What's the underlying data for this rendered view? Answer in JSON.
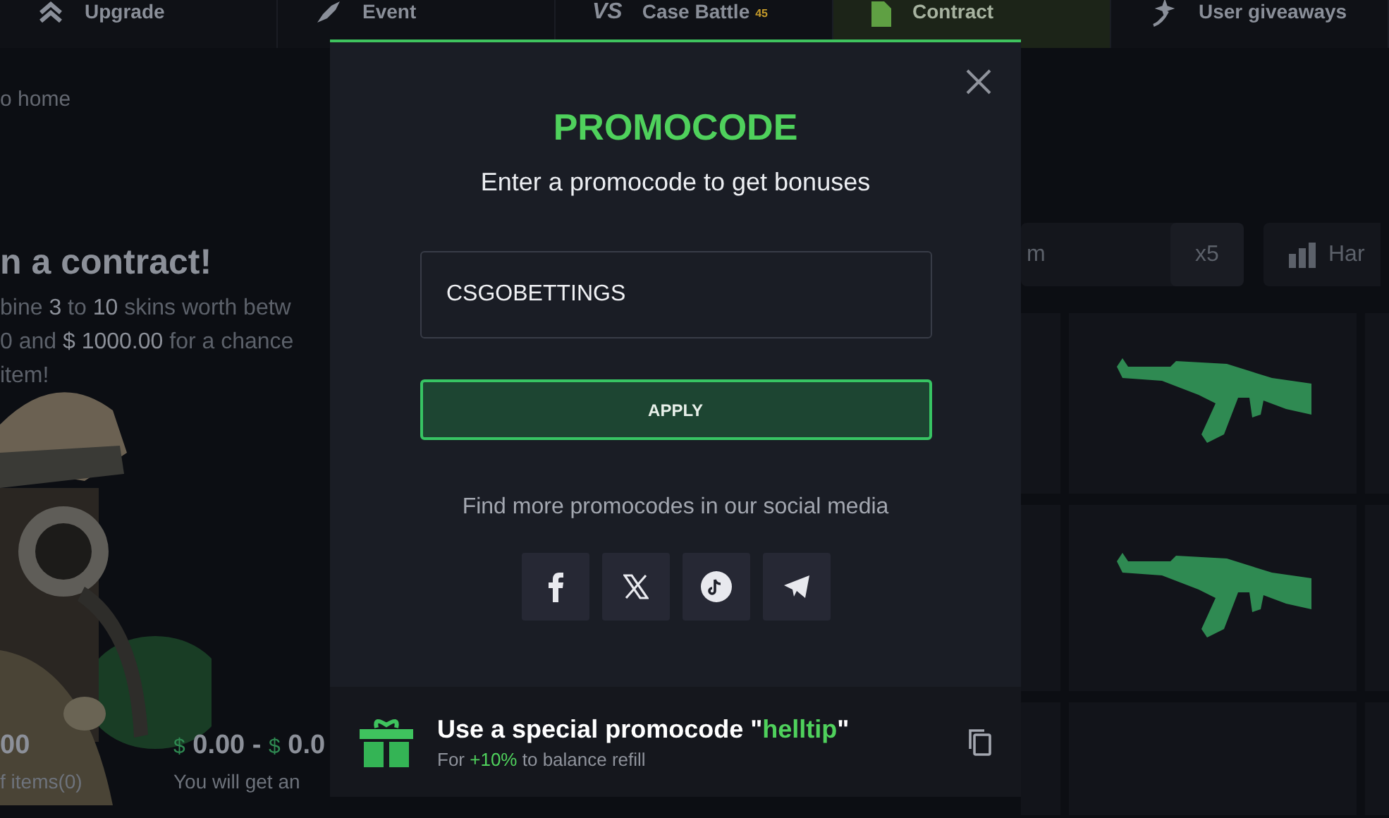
{
  "nav": [
    {
      "kind": "upgrade",
      "label": "Upgrade",
      "selected": false
    },
    {
      "kind": "event",
      "label": "Event",
      "selected": false
    },
    {
      "kind": "battle",
      "glyph": "VS",
      "label": "Case Battle",
      "badge": "45",
      "selected": false
    },
    {
      "kind": "contract",
      "label": "Contract",
      "selected": true
    },
    {
      "kind": "giveaway",
      "label": "User giveaways",
      "selected": false
    }
  ],
  "page": {
    "breadcrumb": "o home",
    "heading": "n a contract!",
    "description": [
      "bine **3** to **10** skins worth betw",
      "0 and **$ 1000.00** for a chance",
      "item!"
    ],
    "stats": [
      {
        "parts": [
          {
            "kind": "amount",
            "text": "00"
          }
        ],
        "label": "f items(0)"
      },
      {
        "parts": [
          {
            "kind": "currency",
            "text": "$"
          },
          {
            "kind": "amount",
            "text": " 0.00 - "
          },
          {
            "kind": "currency",
            "text": "$"
          },
          {
            "kind": "amount",
            "text": " 0.0"
          }
        ],
        "label": "You will get an"
      }
    ]
  },
  "toolbar": {
    "search": {
      "placeholder": "m"
    },
    "multiplier": "x5",
    "difficulty": "Har"
  },
  "cards": [
    {
      "kind": "empty"
    },
    {
      "kind": "rifle"
    },
    {
      "kind": "empty"
    },
    {
      "kind": "empty"
    },
    {
      "kind": "rifle"
    },
    {
      "kind": "empty"
    },
    {
      "kind": "empty"
    },
    {
      "kind": "empty"
    },
    {
      "kind": "empty"
    }
  ],
  "modal": {
    "title": "PROMOCODE",
    "subtitle": "Enter a promocode to get bonuses",
    "code": {
      "value": "CSGOBETTINGS"
    },
    "apply": "APPLY",
    "social_text": "Find more promocodes in our social media",
    "socials": [
      {
        "kind": "facebook"
      },
      {
        "kind": "x"
      },
      {
        "kind": "tiktok"
      },
      {
        "kind": "telegram"
      }
    ],
    "banner": {
      "title": [
        {
          "text": "Use a special promocode \"",
          "kind": "plain"
        },
        {
          "text": "helltip",
          "kind": "accent"
        },
        {
          "text": "\"",
          "kind": "plain"
        }
      ],
      "subtitle": [
        {
          "text": "For ",
          "kind": "plain"
        },
        {
          "text": "+10%",
          "kind": "accent"
        },
        {
          "text": " to balance refill",
          "kind": "plain"
        }
      ]
    }
  }
}
